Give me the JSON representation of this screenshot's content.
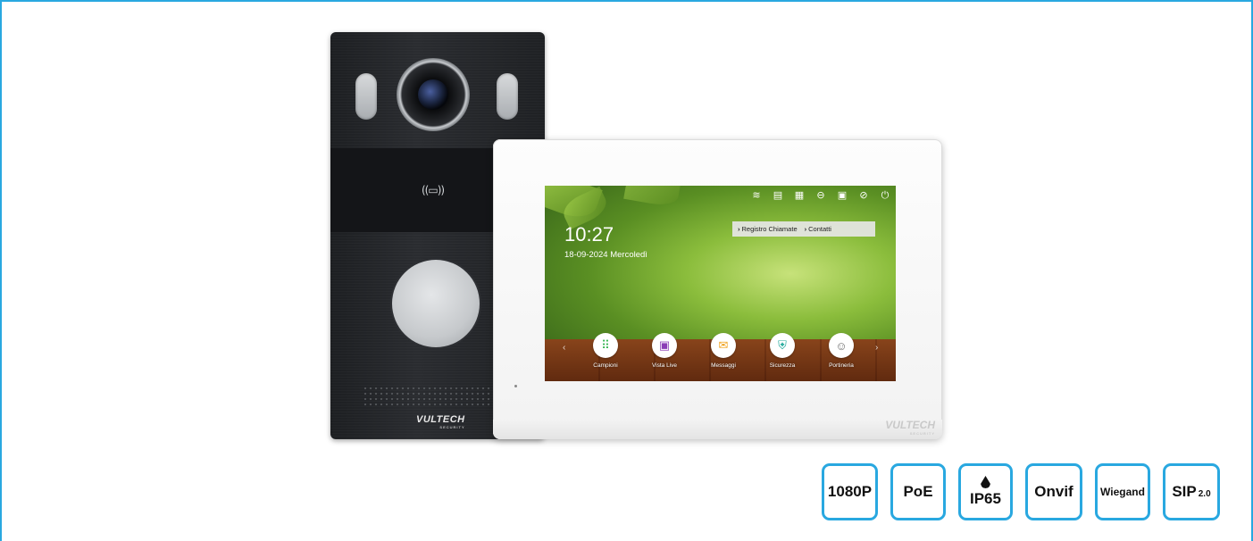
{
  "brand": {
    "station_logo": "VULTECH",
    "monitor_logo": "VULTECH",
    "logo_sub": "SECURITY"
  },
  "door_station": {
    "rfid_icon": "((▭))"
  },
  "monitor_screen": {
    "time": "10:27",
    "date": "18-09-2024 Mercoledì",
    "quicklinks": [
      {
        "label": "Registro Chiamate"
      },
      {
        "label": "Contatti"
      }
    ],
    "status_icons": [
      "wifi-icon",
      "message-icon",
      "qr-icon",
      "cloud-icon",
      "door-icon",
      "dnd-icon",
      "power-icon"
    ],
    "apps": [
      {
        "label": "Campioni",
        "icon": "keypad-icon",
        "color": "#2fb24a",
        "glyph": "⠿"
      },
      {
        "label": "Vista Live",
        "icon": "intercom-icon",
        "color": "#8b3db6",
        "glyph": "▣"
      },
      {
        "label": "Messaggi",
        "icon": "mail-icon",
        "color": "#f0a01a",
        "glyph": "✉"
      },
      {
        "label": "Sicurezza",
        "icon": "shield-icon",
        "color": "#1fa89a",
        "glyph": "⛨"
      },
      {
        "label": "Portineria",
        "icon": "concierge-icon",
        "color": "#6b6b6b",
        "glyph": "☺"
      }
    ]
  },
  "badges": [
    {
      "label": "1080P",
      "size": "big"
    },
    {
      "label": "PoE",
      "size": "big"
    },
    {
      "label": "IP65",
      "size": "big",
      "icon": "water-drop-icon"
    },
    {
      "label": "Onvif",
      "size": "big"
    },
    {
      "label": "Wiegand",
      "size": "small"
    },
    {
      "label": "SIP",
      "sub": "2.0",
      "size": "big"
    }
  ],
  "colors": {
    "frame_accent": "#29a8e0",
    "station_body": "#1d1f22",
    "monitor_body": "#f5f5f5"
  }
}
